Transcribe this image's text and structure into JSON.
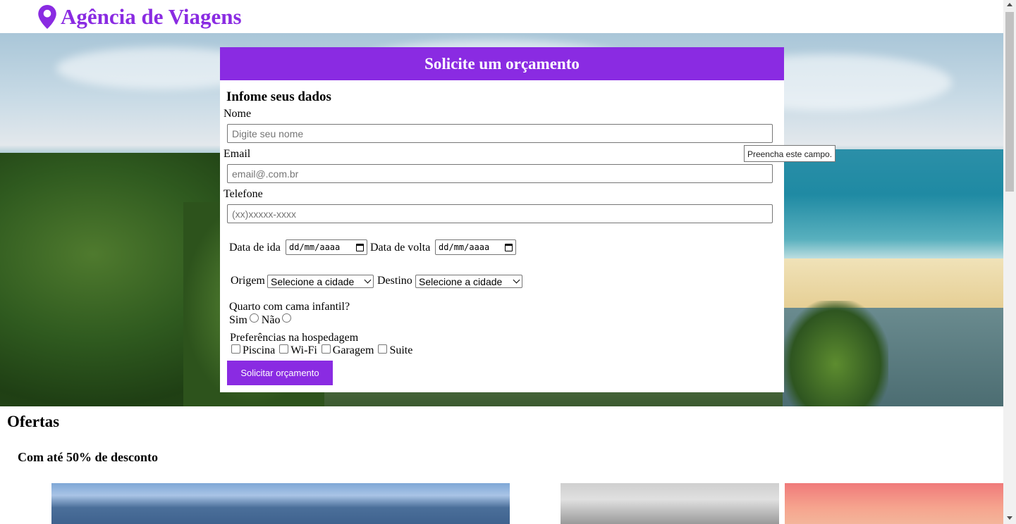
{
  "header": {
    "title": "Agência de Viagens",
    "icon": "map-pin-icon",
    "accent": "#8a2be2"
  },
  "form": {
    "heading": "Solicite um orçamento",
    "legend": "Infome seus dados",
    "name": {
      "label": "Nome",
      "placeholder": "Digite seu nome"
    },
    "email": {
      "label": "Email",
      "placeholder": "email@.com.br"
    },
    "phone": {
      "label": "Telefone",
      "placeholder": "(xx)xxxxx-xxxx"
    },
    "depart": {
      "label": "Data de ida",
      "value": "dd/mm/aaaa"
    },
    "return": {
      "label": "Data de volta",
      "value": "dd/mm/aaaa"
    },
    "origin": {
      "label": "Origem",
      "selected": "Selecione a cidade"
    },
    "destination": {
      "label": "Destino",
      "selected": "Selecione a cidade"
    },
    "child_bed": {
      "question": "Quarto com cama infantil?",
      "yes": "Sim",
      "no": "Não"
    },
    "prefs": {
      "label": "Preferências na hospedagem",
      "options": [
        "Piscina",
        "Wi-Fi",
        "Garagem",
        "Suite"
      ]
    },
    "submit": "Solicitar orçamento",
    "tooltip": "Preencha este campo."
  },
  "offers": {
    "title": "Ofertas",
    "subtitle": "Com até 50% de desconto"
  }
}
